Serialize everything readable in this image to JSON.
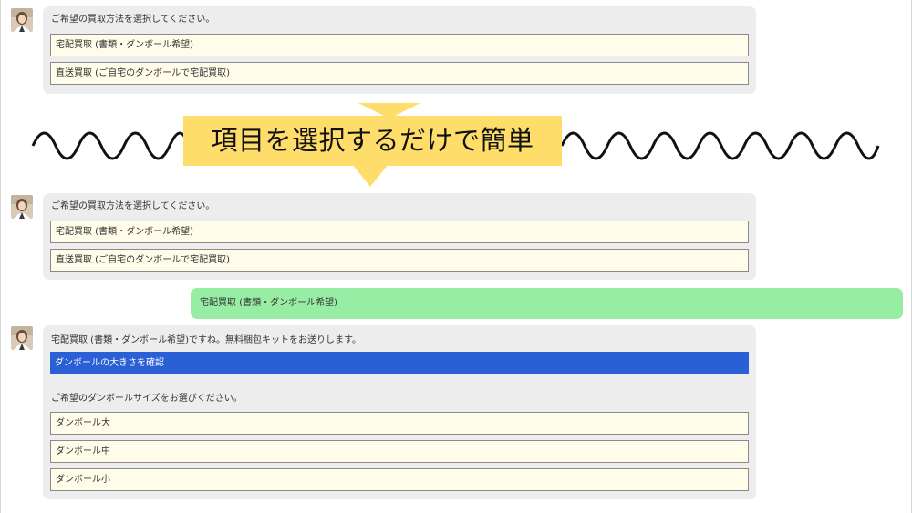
{
  "chat1": {
    "prompt": "ご希望の買取方法を選択してください。",
    "options": [
      "宅配買取 (書類・ダンボール希望)",
      "直送買取 (ご自宅のダンボールで宅配買取)"
    ]
  },
  "banner": {
    "text": "項目を選択するだけで簡単"
  },
  "chat2": {
    "prompt": "ご希望の買取方法を選択してください。",
    "options": [
      "宅配買取 (書類・ダンボール希望)",
      "直送買取 (ご自宅のダンボールで宅配買取)"
    ]
  },
  "user_reply": {
    "text": "宅配買取 (書類・ダンボール希望)"
  },
  "chat3": {
    "intro": "宅配買取 (書類・ダンボール希望)ですね。無料梱包キットをお送りします。",
    "check_button": "ダンボールの大きさを確認",
    "prompt": "ご希望のダンボールサイズをお選びください。",
    "options": [
      "ダンボール大",
      "ダンボール中",
      "ダンボール小"
    ]
  },
  "colors": {
    "bubble_bg": "#ededed",
    "option_bg": "#fffdea",
    "user_bubble_bg": "#97eda3",
    "primary_button": "#2a5fd6",
    "banner_bg": "#ffdd6b"
  }
}
